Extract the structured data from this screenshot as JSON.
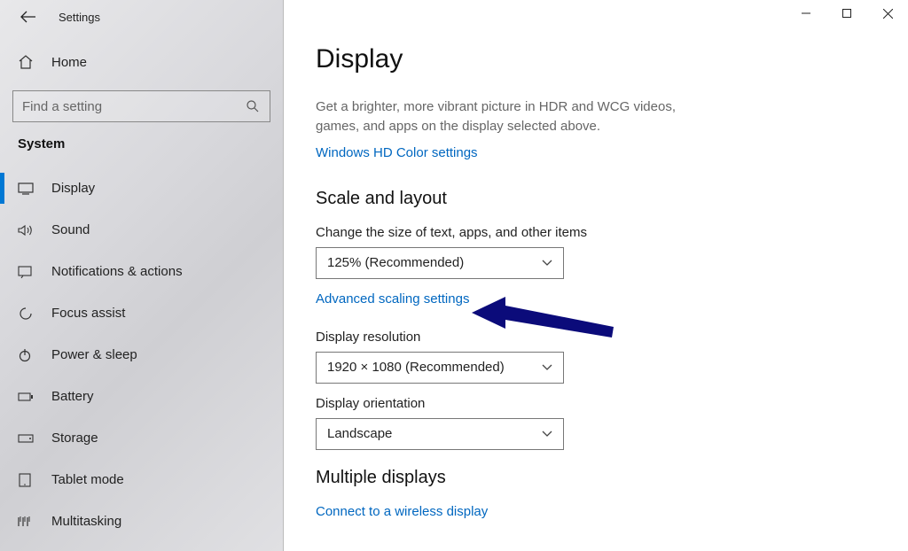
{
  "titlebar": {
    "title": "Settings"
  },
  "sidebar": {
    "home_label": "Home",
    "search_placeholder": "Find a setting",
    "section_title": "System",
    "items": [
      {
        "icon": "display",
        "label": "Display",
        "active": true
      },
      {
        "icon": "sound",
        "label": "Sound",
        "active": false
      },
      {
        "icon": "notifications",
        "label": "Notifications & actions",
        "active": false
      },
      {
        "icon": "focus",
        "label": "Focus assist",
        "active": false
      },
      {
        "icon": "power",
        "label": "Power & sleep",
        "active": false
      },
      {
        "icon": "battery",
        "label": "Battery",
        "active": false
      },
      {
        "icon": "storage",
        "label": "Storage",
        "active": false
      },
      {
        "icon": "tablet",
        "label": "Tablet mode",
        "active": false
      },
      {
        "icon": "multitask",
        "label": "Multitasking",
        "active": false
      }
    ]
  },
  "content": {
    "page_title": "Display",
    "hdr_subtext": "Get a brighter, more vibrant picture in HDR and WCG videos, games, and apps on the display selected above.",
    "hdr_link": "Windows HD Color settings",
    "scale_section": "Scale and layout",
    "scale_label": "Change the size of text, apps, and other items",
    "scale_value": "125% (Recommended)",
    "advanced_scaling_link": "Advanced scaling settings",
    "resolution_label": "Display resolution",
    "resolution_value": "1920 × 1080 (Recommended)",
    "orientation_label": "Display orientation",
    "orientation_value": "Landscape",
    "multi_section": "Multiple displays",
    "wireless_link": "Connect to a wireless display"
  },
  "colors": {
    "annotation_arrow": "#0b0b7a"
  }
}
